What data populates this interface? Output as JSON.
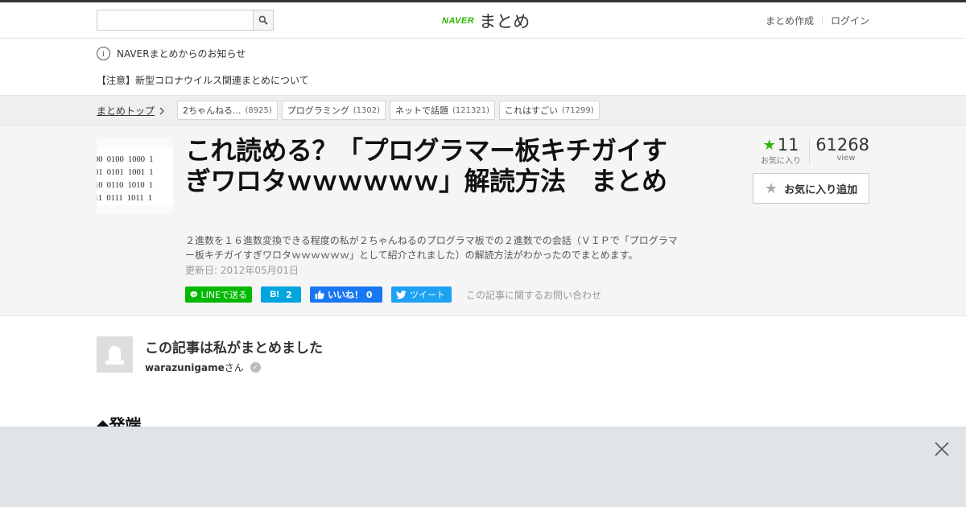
{
  "header": {
    "search_placeholder": "",
    "logo_brand": "NAVER",
    "logo_text": "まとめ",
    "links": [
      "まとめ作成",
      "ログイン"
    ]
  },
  "notice": {
    "heading": "NAVERまとめからのお知らせ",
    "item": "【注意】新型コロナウイルス関連まとめについて"
  },
  "breadcrumb": {
    "home": "まとめトップ",
    "tags": [
      {
        "label": "2ちゃんねる...",
        "count": "(8925)"
      },
      {
        "label": "プログラミング",
        "count": "(1302)"
      },
      {
        "label": "ネットで話題",
        "count": "(121321)"
      },
      {
        "label": "これはすごい",
        "count": "(71299)"
      }
    ]
  },
  "article": {
    "title": "これ読める？「プログラマー板キチガイすぎワロタｗｗｗｗｗｗ」解読方法　まとめ",
    "description": "２進数を１６進数変換できる程度の私が２ちゃんねるのプログラマ板での２進数での会話（ＶＩＰで「プログラマー板キチガイすぎワロタｗｗｗｗｗｗ」として紹介されました）の解読方法がわかったのでまとめます。",
    "updated": "更新日: 2012年05月01日",
    "thumbnail_lines": [
      "00  0100  1000  1",
      "01  0101  1001  1",
      "10  0110  1010  1",
      "11  0111  1011  1"
    ],
    "favorites": "11",
    "favorites_label": "お気に入り",
    "views": "61268",
    "views_label": "view",
    "fav_button": "お気に入り追加"
  },
  "share": {
    "line": "LINEで送る",
    "hatena_count": "2",
    "fb": "いいね！ 0",
    "tweet": "ツイート",
    "contact": "この記事に関するお問い合わせ"
  },
  "author": {
    "heading": "この記事は私がまとめました",
    "name": "warazunigame",
    "suffix": "さん"
  },
  "section": {
    "heading": "◆発端"
  },
  "colors": {
    "naver_green": "#2db400",
    "line_green": "#00b900",
    "hatena_blue": "#00a4de",
    "facebook_blue": "#1877f2",
    "twitter_blue": "#1da1f2"
  },
  "icons": [
    "search-icon",
    "info-icon",
    "chevron-right-icon",
    "star-icon",
    "line-icon",
    "hatena-icon",
    "thumbs-up-icon",
    "twitter-bird-icon",
    "verified-check-icon",
    "close-icon"
  ]
}
